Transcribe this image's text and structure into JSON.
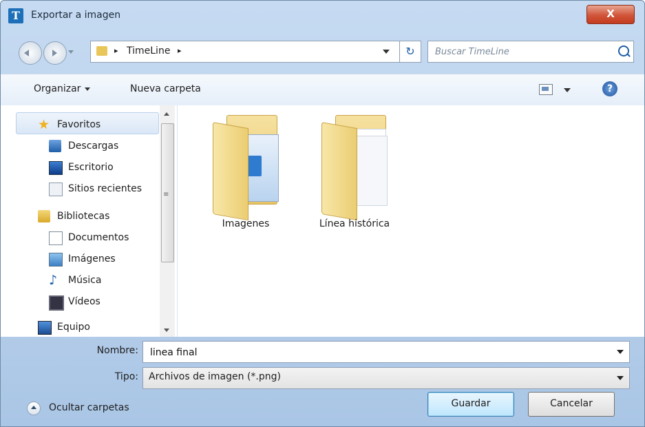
{
  "window": {
    "title": "Exportar a imagen",
    "app_icon_letter": "T",
    "close_glyph": "X"
  },
  "address": {
    "breadcrumb_arrow": "▸",
    "path": [
      "TimeLine"
    ],
    "refresh_glyph": "↻"
  },
  "search": {
    "placeholder": "Buscar TimeLine"
  },
  "toolbar": {
    "organize_label": "Organizar",
    "new_folder_label": "Nueva carpeta",
    "help_glyph": "?"
  },
  "sidebar": {
    "favorites": {
      "label": "Favoritos",
      "items": [
        "Descargas",
        "Escritorio",
        "Sitios recientes"
      ]
    },
    "libraries": {
      "label": "Bibliotecas",
      "items": [
        "Documentos",
        "Imágenes",
        "Música",
        "Vídeos"
      ]
    },
    "computer": {
      "label": "Equipo"
    },
    "scroll_grip": "≡"
  },
  "content": {
    "folders": [
      {
        "name": "Imagenes",
        "icon": "folder-with-image-icon"
      },
      {
        "name": "Línea histórica",
        "icon": "folder-with-documents-icon"
      }
    ]
  },
  "form": {
    "name_label": "Nombre:",
    "name_value": "linea final",
    "type_label": "Tipo:",
    "type_value": "Archivos de imagen (*.png)"
  },
  "footer": {
    "hide_folders_label": "Ocultar carpetas",
    "save_label": "Guardar",
    "cancel_label": "Cancelar"
  },
  "colors": {
    "chrome": "#b7cfea",
    "close": "#c43c1f",
    "accent": "#1f5ea8"
  }
}
